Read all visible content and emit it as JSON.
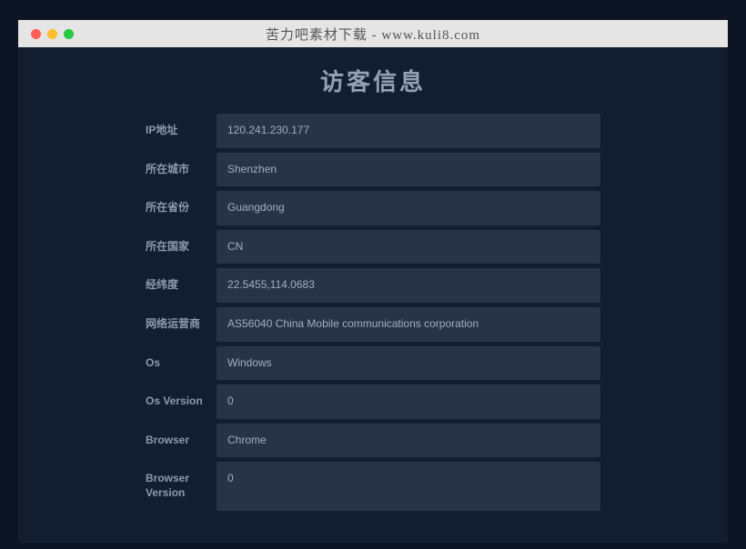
{
  "titlebar": {
    "title": "苦力吧素材下载 - www.kuli8.com"
  },
  "page": {
    "heading": "访客信息"
  },
  "info": {
    "rows": [
      {
        "label": "IP地址",
        "value": "120.241.230.177"
      },
      {
        "label": "所在城市",
        "value": "Shenzhen"
      },
      {
        "label": "所在省份",
        "value": "Guangdong"
      },
      {
        "label": "所在国家",
        "value": "CN"
      },
      {
        "label": "经纬度",
        "value": "22.5455,114.0683"
      },
      {
        "label": "网络运营商",
        "value": "AS56040 China Mobile communications corporation"
      },
      {
        "label": "Os",
        "value": "Windows"
      },
      {
        "label": "Os Version",
        "value": "0"
      },
      {
        "label": "Browser",
        "value": "Chrome"
      },
      {
        "label": "Browser Version",
        "value": "0"
      }
    ]
  }
}
